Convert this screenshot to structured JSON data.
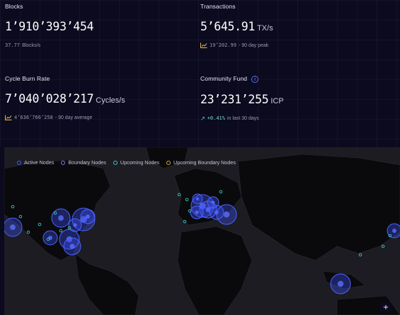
{
  "stats": {
    "blocks": {
      "label": "Blocks",
      "value": "1’910’393’454",
      "sub_num": "37.77",
      "sub_text": "Blocks/s"
    },
    "transactions": {
      "label": "Transactions",
      "value": "5’645.91",
      "unit": "TX/s",
      "sub_num": "19’202.99",
      "sub_text": "- 90 day peak",
      "icon": "chart-trend-icon"
    },
    "cycle_burn": {
      "label": "Cycle Burn Rate",
      "value": "7’040’028’217",
      "unit": "Cycles/s",
      "sub_num": "4’636’766’258",
      "sub_text": "- 90 day average",
      "icon": "chart-trend-icon"
    },
    "community_fund": {
      "label": "Community Fund",
      "info": "i",
      "value": "23’231’255",
      "unit": "ICP",
      "sub_arrow": "↗",
      "sub_num": "+0.41%",
      "sub_text": "in last 30 days"
    }
  },
  "map": {
    "legend": [
      {
        "label": "Active Nodes",
        "color": "#4a5cff"
      },
      {
        "label": "Boundary Nodes",
        "color": "#6b7cff"
      },
      {
        "label": "Upcoming Nodes",
        "color": "#38c7c7"
      },
      {
        "label": "Upcoming Boundary Nodes",
        "color": "#c9a34a"
      }
    ],
    "zoom_label": "+"
  },
  "colors": {
    "background": "#0b0a1f",
    "map_bg": "#1c1c22",
    "land": "#0a0a0c",
    "node": "#3e54ff",
    "upcoming": "#38c7c7",
    "trend_icon": "#e8b84a"
  }
}
